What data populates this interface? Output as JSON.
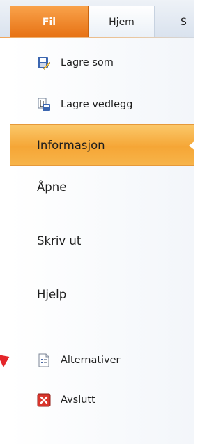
{
  "tabs": {
    "file": "Fil",
    "home": "Hjem",
    "next": "S"
  },
  "menu": {
    "save_as": "Lagre som",
    "save_attachment": "Lagre vedlegg",
    "info": "Informasjon",
    "open": "Åpne",
    "print": "Skriv ut",
    "help": "Hjelp",
    "options": "Alternativer",
    "exit": "Avslutt"
  },
  "colors": {
    "file_tab": "#e67012",
    "active_item": "#f5a636",
    "callout_arrow": "#e4252a"
  },
  "icons": {
    "save_as": "save-as-icon",
    "save_attachment": "save-attachment-icon",
    "options": "options-icon",
    "exit": "exit-icon"
  }
}
